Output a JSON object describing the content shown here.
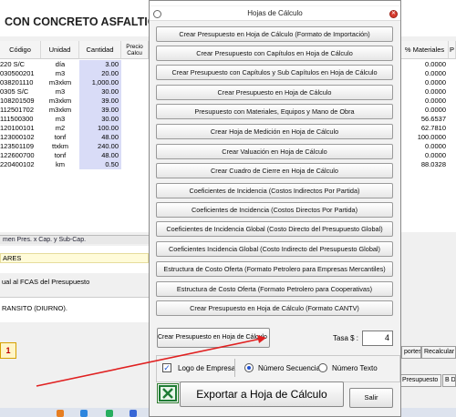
{
  "background": {
    "title": "CON CONCRETO ASFALTICO EN",
    "columns": {
      "codigo": "Código",
      "unidad": "Unidad",
      "cantidad": "Cantidad",
      "precio_partial": "Precio Calcu",
      "materiales": "% Materiales",
      "tail": "P"
    },
    "rows": [
      {
        "codigo": "220 S/C",
        "unidad": "día",
        "cantidad": "3.00",
        "materiales": "0.0000"
      },
      {
        "codigo": "030500201",
        "unidad": "m3",
        "cantidad": "20.00",
        "materiales": "0.0000"
      },
      {
        "codigo": "038201110",
        "unidad": "m3xkm",
        "cantidad": "1,000.00",
        "materiales": "0.0000"
      },
      {
        "codigo": "0305 S/C",
        "unidad": "m3",
        "cantidad": "30.00",
        "materiales": "0.0000"
      },
      {
        "codigo": "108201509",
        "unidad": "m3xkm",
        "cantidad": "39.00",
        "materiales": "0.0000"
      },
      {
        "codigo": "112501702",
        "unidad": "m3xkm",
        "cantidad": "39.00",
        "materiales": "0.0000"
      },
      {
        "codigo": "111500300",
        "unidad": "m3",
        "cantidad": "30.00",
        "materiales": "56.6537"
      },
      {
        "codigo": "120100101",
        "unidad": "m2",
        "cantidad": "100.00",
        "materiales": "62.7810"
      },
      {
        "codigo": "123000102",
        "unidad": "tonf",
        "cantidad": "48.00",
        "materiales": "100.0000"
      },
      {
        "codigo": "123501109",
        "unidad": "ttxkm",
        "cantidad": "240.00",
        "materiales": "0.0000"
      },
      {
        "codigo": "122600700",
        "unidad": "tonf",
        "cantidad": "48.00",
        "materiales": "0.0000"
      },
      {
        "codigo": "220400102",
        "unidad": "km",
        "cantidad": "0.50",
        "materiales": "88.0328"
      }
    ],
    "tabs_text": "men Pres. x Cap. y Sub-Cap.",
    "yellow_strip": "ARES",
    "text1": "ual al FCAS del Presupuesto",
    "text2": "RANSITO (DIURNO).",
    "number_box": "1",
    "right_buttons_top": [
      "portes",
      "Recalcular"
    ],
    "right_buttons_bottom": [
      "Presupuesto",
      "B D"
    ]
  },
  "dialog": {
    "title": "Hojas de Cálculo",
    "buttons": [
      "Crear Presupuesto en Hoja de Cálculo (Formato de Importación)",
      "Crear Presupuesto con Capítulos en Hoja de Cálculo",
      "Crear Presupuesto con Capítulos y Sub Capítulos en Hoja de Cálculo",
      "Crear Presupuesto en Hoja de Cálculo",
      "Presupuesto con Materiales, Equipos y Mano de Obra",
      "Crear Hoja de Medición en Hoja de Cálculo",
      "Crear Valuación en Hoja de Cálculo",
      "Crear Cuadro de Cierre en Hoja de Cálculo",
      "Coeficientes de Incidencia (Costos Indirectos Por Partida)",
      "Coeficientes de Incidencia (Costos Directos Por Partida)",
      "Coeficientes de Incidencia Global (Costo Directo del Presupuesto Global)",
      "Coeficientes Incidencia Global (Costo Indirecto del Presupuesto Global)",
      "Estructura de Costo Oferta (Formato Petrolero para Empresas Mercantiles)",
      "Estructura de Costo Oferta (Formato Petrolero para Cooperativas)",
      "Crear Presupuesto en Hoja de Cálculo (Formato CANTV)"
    ],
    "format_button": "Crear Presupuesto en Hoja de Cálculo (Formato Us$ - Bs)",
    "tasa_label": "Tasa $ :",
    "tasa_value": "4",
    "logo_label": "Logo de Empresa",
    "logo_checked": true,
    "radio_seq_label": "Número Secuencial",
    "radio_text_label": "Número Texto",
    "export_label": "Exportar a Hoja de Cálculo",
    "salir_label": "Salir"
  },
  "colors": {
    "arrow": "#e02020",
    "qty_column": "#d9dcf7",
    "close_button": "#d83b2e"
  }
}
